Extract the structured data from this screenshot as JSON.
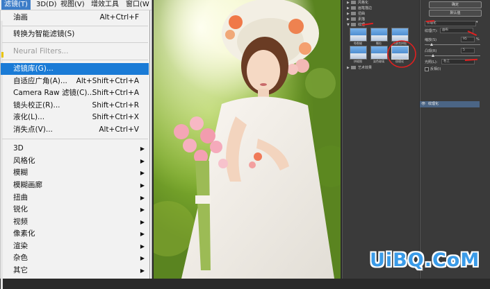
{
  "menubar": {
    "items": [
      "滤镜(T)",
      "3D(D)",
      "视图(V)",
      "增效工具",
      "窗口(W"
    ]
  },
  "menu": {
    "top": [
      {
        "label": "油画",
        "shortcut": "Alt+Ctrl+F"
      },
      {
        "label": "转换为智能滤镜(S)",
        "shortcut": ""
      },
      {
        "label": "Neural Filters...",
        "shortcut": "",
        "disabled": true
      },
      {
        "label": "滤镜库(G)...",
        "shortcut": "",
        "highlighted": true
      },
      {
        "label": "自适应广角(A)...",
        "shortcut": "Alt+Shift+Ctrl+A"
      },
      {
        "label": "Camera Raw 滤镜(C)...",
        "shortcut": "Shift+Ctrl+A"
      },
      {
        "label": "镜头校正(R)...",
        "shortcut": "Shift+Ctrl+R"
      },
      {
        "label": "液化(L)...",
        "shortcut": "Shift+Ctrl+X"
      },
      {
        "label": "消失点(V)...",
        "shortcut": "Alt+Ctrl+V"
      }
    ],
    "submenus": [
      "3D",
      "风格化",
      "模糊",
      "模糊画廊",
      "扭曲",
      "锐化",
      "视频",
      "像素化",
      "渲染",
      "杂色",
      "其它"
    ]
  },
  "gallery": {
    "tree": [
      {
        "label": "风格化",
        "open": false
      },
      {
        "label": "画笔描边",
        "open": false
      },
      {
        "label": "扭曲",
        "open": false
      },
      {
        "label": "素描",
        "open": false
      },
      {
        "label": "纹理",
        "open": true
      },
      {
        "label": "艺术效果",
        "open": false
      }
    ],
    "thumbs": [
      "龟裂缝",
      "颗粒",
      "马赛克拼贴",
      "拼缀图",
      "染色玻璃",
      "纹理化"
    ]
  },
  "settings": {
    "ok_label": "确定",
    "default_label": "默认值",
    "filter_select": "纹理化",
    "texture_label": "纹理(T):",
    "texture_value": "画布",
    "scaling_label": "缩放(S)",
    "scaling_value": "95",
    "scaling_unit": "%",
    "relief_label": "凸现(R)",
    "relief_value": "5",
    "light_label": "光照(L):",
    "light_value": "右上",
    "invert_label": "反相(I)",
    "layer_name": "纹理化"
  },
  "watermark": "UiBQ.CoM",
  "colors": {
    "menu_highlight": "#1a7bd6",
    "panel_bg": "#3a3a3a",
    "annotation_red": "#e02020",
    "watermark_blue": "#3a9be8"
  }
}
